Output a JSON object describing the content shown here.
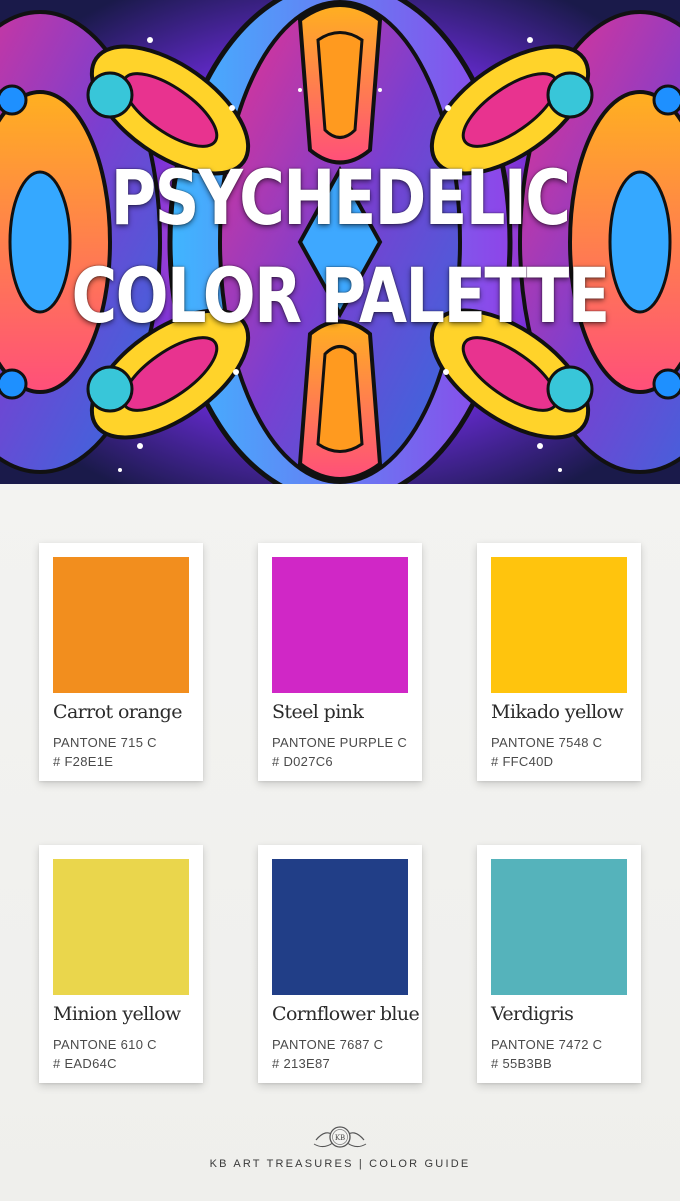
{
  "hero": {
    "title_line1": "PSYCHEDELIC",
    "title_line2": "COLOR PALETTE"
  },
  "colors": [
    {
      "name": "Carrot orange",
      "pantone": "PANTONE 715 C",
      "hex_label": "# F28E1E",
      "hex": "#F28E1E"
    },
    {
      "name": "Steel pink",
      "pantone": "PANTONE PURPLE C",
      "hex_label": "# D027C6",
      "hex": "#D027C6"
    },
    {
      "name": "Mikado yellow",
      "pantone": "PANTONE 7548 C",
      "hex_label": "# FFC40D",
      "hex": "#FFC40D"
    },
    {
      "name": "Minion yellow",
      "pantone": "PANTONE 610 C",
      "hex_label": "# EAD64C",
      "hex": "#EAD64C"
    },
    {
      "name": "Cornflower blue",
      "pantone": "PANTONE 7687 C",
      "hex_label": "# 213E87",
      "hex": "#213E87"
    },
    {
      "name": "Verdigris",
      "pantone": "PANTONE 7472 C",
      "hex_label": "# 55B3BB",
      "hex": "#55B3BB"
    }
  ],
  "footer": {
    "logo_text": "KB",
    "text": "KB ART TREASURES | COLOR GUIDE"
  }
}
